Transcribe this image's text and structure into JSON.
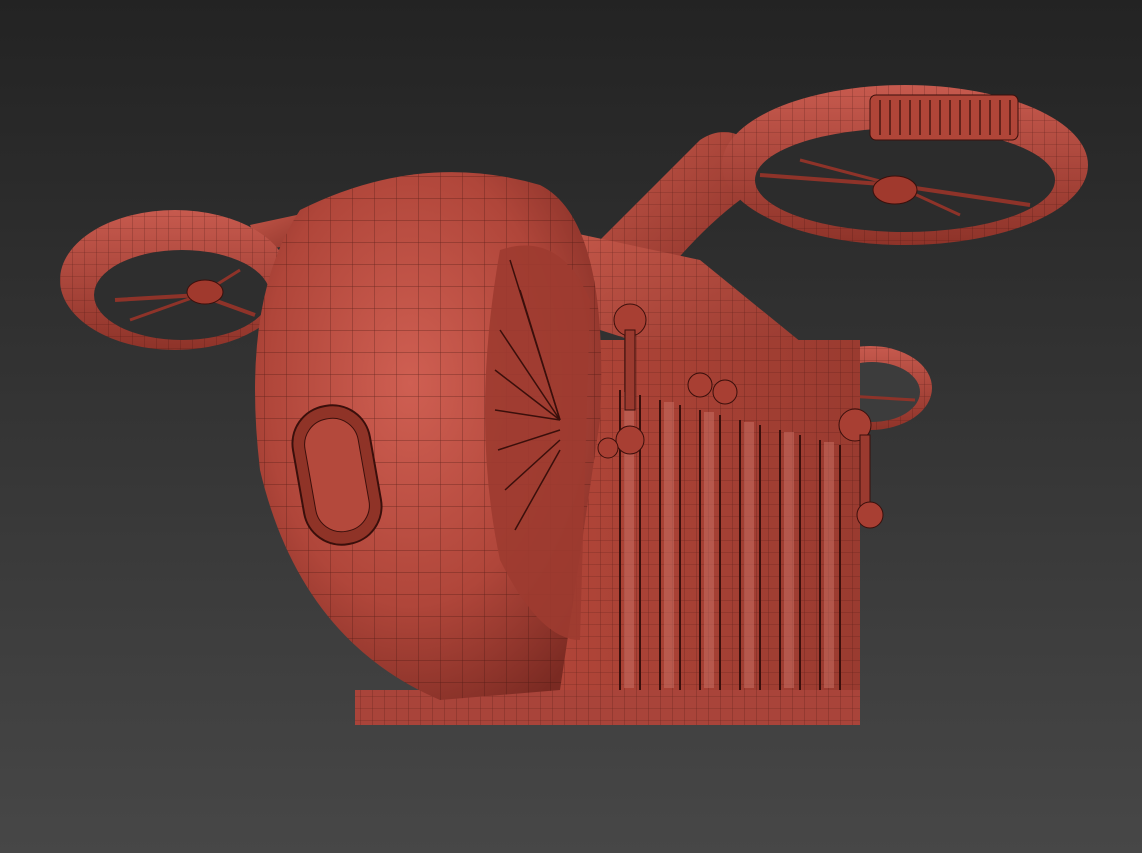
{
  "viewport": {
    "background_top": "#232323",
    "background_bottom": "#474747"
  },
  "model": {
    "subject": "cargo-drone-wireframe",
    "shade_color": "#b5483c",
    "shade_dark": "#7a2a22",
    "shade_light": "#d0645a",
    "wire_color": "#3a0f0b"
  }
}
